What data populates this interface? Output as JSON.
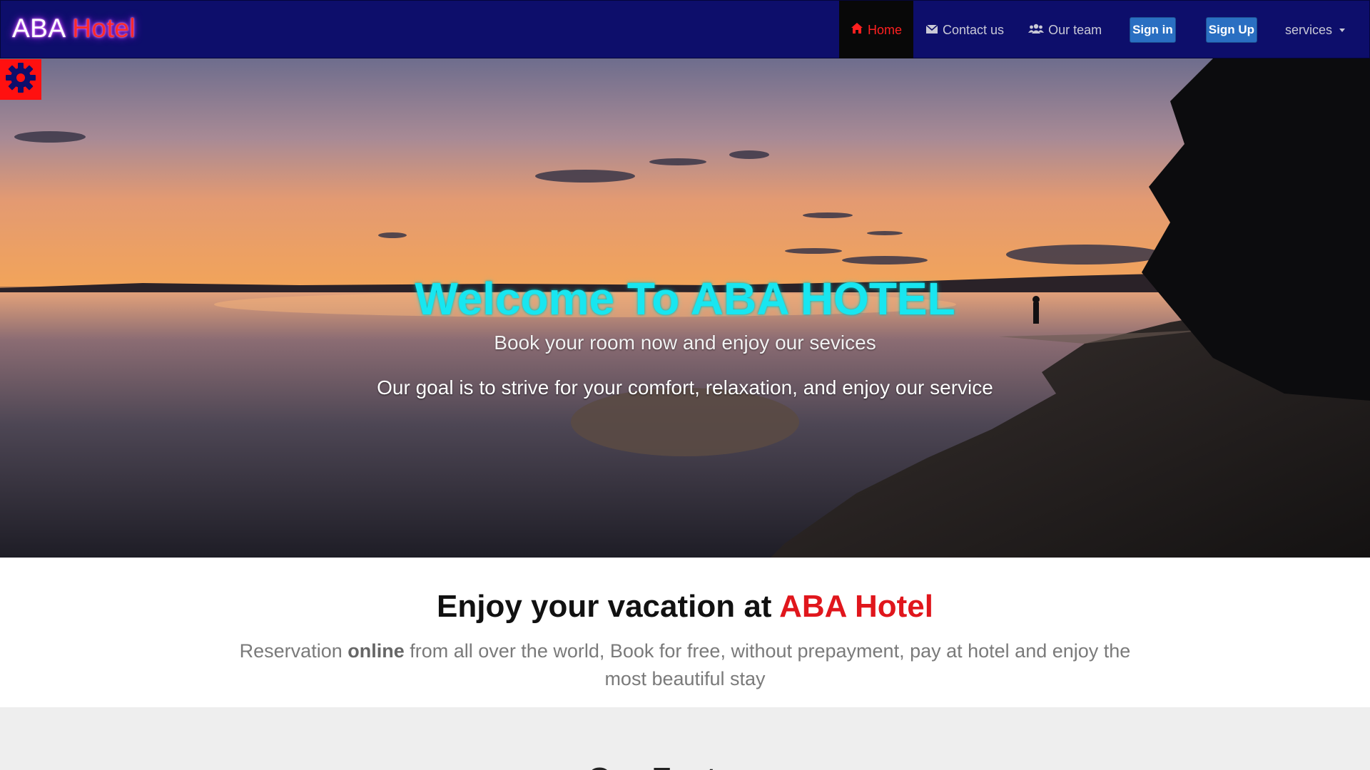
{
  "brand": {
    "part1": "ABA",
    "part2": "Hotel"
  },
  "nav": {
    "home": "Home",
    "contact": "Contact us",
    "team": "Our team",
    "sign_in": "Sign in",
    "sign_up": "Sign Up",
    "services": "services"
  },
  "hero": {
    "title": "Welcome To ABA HOTEL",
    "subtitle": "Book your room now and enjoy our sevices",
    "tagline": "Our goal is to strive for your comfort, relaxation, and enjoy our service"
  },
  "intro": {
    "heading_prefix": "Enjoy your vacation at",
    "heading_highlight": "ABA Hotel",
    "text_before": "Reservation",
    "text_bold": "online",
    "text_after": "from all over the world, Book for free, without prepayment, pay at hotel and enjoy the most beautiful stay"
  },
  "features": {
    "heading": "Our Features"
  },
  "colors": {
    "navbar": "#0d0e6b",
    "active_nav": "#080808",
    "home_active": "#ff2020",
    "button": "#2a6fc2",
    "hero_title": "#18e6f0",
    "accent_red": "#e0161c",
    "gear_bg": "#ff1010"
  },
  "icons": {
    "home": "home-icon",
    "contact": "envelope-icon",
    "team": "users-icon",
    "settings": "gear-icon"
  }
}
